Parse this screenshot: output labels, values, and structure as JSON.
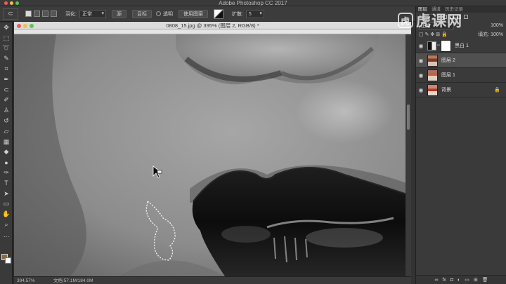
{
  "app": {
    "title": "Adobe Photoshop CC 2017"
  },
  "options_bar": {
    "feather_label": "羽化:",
    "blend_select": "正常",
    "source_btn": "源",
    "target_btn": "目标",
    "transparent_label": "透明",
    "use_pattern_btn": "使用图案",
    "spread_label": "扩散:",
    "spread_value": "5"
  },
  "document": {
    "tab_title": "0808_15.jpg @ 395% (图层 2, RGB/8) *",
    "zoom": "394.57%",
    "doc_info": "文档:57.1M/184.0M"
  },
  "toolbar": {
    "tools": [
      {
        "name": "move-tool-icon",
        "glyph": "✥"
      },
      {
        "name": "marquee-tool-icon",
        "glyph": "⬚"
      },
      {
        "name": "lasso-tool-icon",
        "glyph": "➰"
      },
      {
        "name": "quick-select-tool-icon",
        "glyph": "✎"
      },
      {
        "name": "crop-tool-icon",
        "glyph": "⌗"
      },
      {
        "name": "eyedropper-tool-icon",
        "glyph": "✒"
      },
      {
        "name": "patch-tool-icon",
        "glyph": "⊂"
      },
      {
        "name": "brush-tool-icon",
        "glyph": "✐"
      },
      {
        "name": "stamp-tool-icon",
        "glyph": "♙"
      },
      {
        "name": "history-brush-icon",
        "glyph": "↺"
      },
      {
        "name": "eraser-tool-icon",
        "glyph": "▱"
      },
      {
        "name": "gradient-tool-icon",
        "glyph": "▦"
      },
      {
        "name": "blur-tool-icon",
        "glyph": "◆"
      },
      {
        "name": "dodge-tool-icon",
        "glyph": "●"
      },
      {
        "name": "pen-tool-icon",
        "glyph": "✑"
      },
      {
        "name": "type-tool-icon",
        "glyph": "T"
      },
      {
        "name": "path-select-tool-icon",
        "glyph": "➤"
      },
      {
        "name": "shape-tool-icon",
        "glyph": "▭"
      },
      {
        "name": "hand-tool-icon",
        "glyph": "✋"
      },
      {
        "name": "zoom-tool-icon",
        "glyph": "⌕"
      },
      {
        "name": "more-tools-icon",
        "glyph": "…"
      }
    ]
  },
  "layers_panel": {
    "tabs": [
      "图层",
      "通道",
      "历史记录"
    ],
    "mode": "正常",
    "opacity": "100%",
    "fill_label": "填充:",
    "fill": "100%",
    "layers": [
      {
        "name": "黑白 1",
        "kind": "adjustment",
        "selected": false
      },
      {
        "name": "图层 2",
        "kind": "pixel2",
        "selected": true
      },
      {
        "name": "图层 1",
        "kind": "pixel1",
        "selected": false
      },
      {
        "name": "背景",
        "kind": "background",
        "selected": false
      }
    ],
    "bottom_icons": [
      "link-icon",
      "fx-icon",
      "mask-icon",
      "adjustment-icon",
      "folder-icon",
      "new-layer-icon",
      "trash-icon"
    ]
  },
  "watermark": {
    "logo": "虎",
    "text": "虎课网"
  }
}
